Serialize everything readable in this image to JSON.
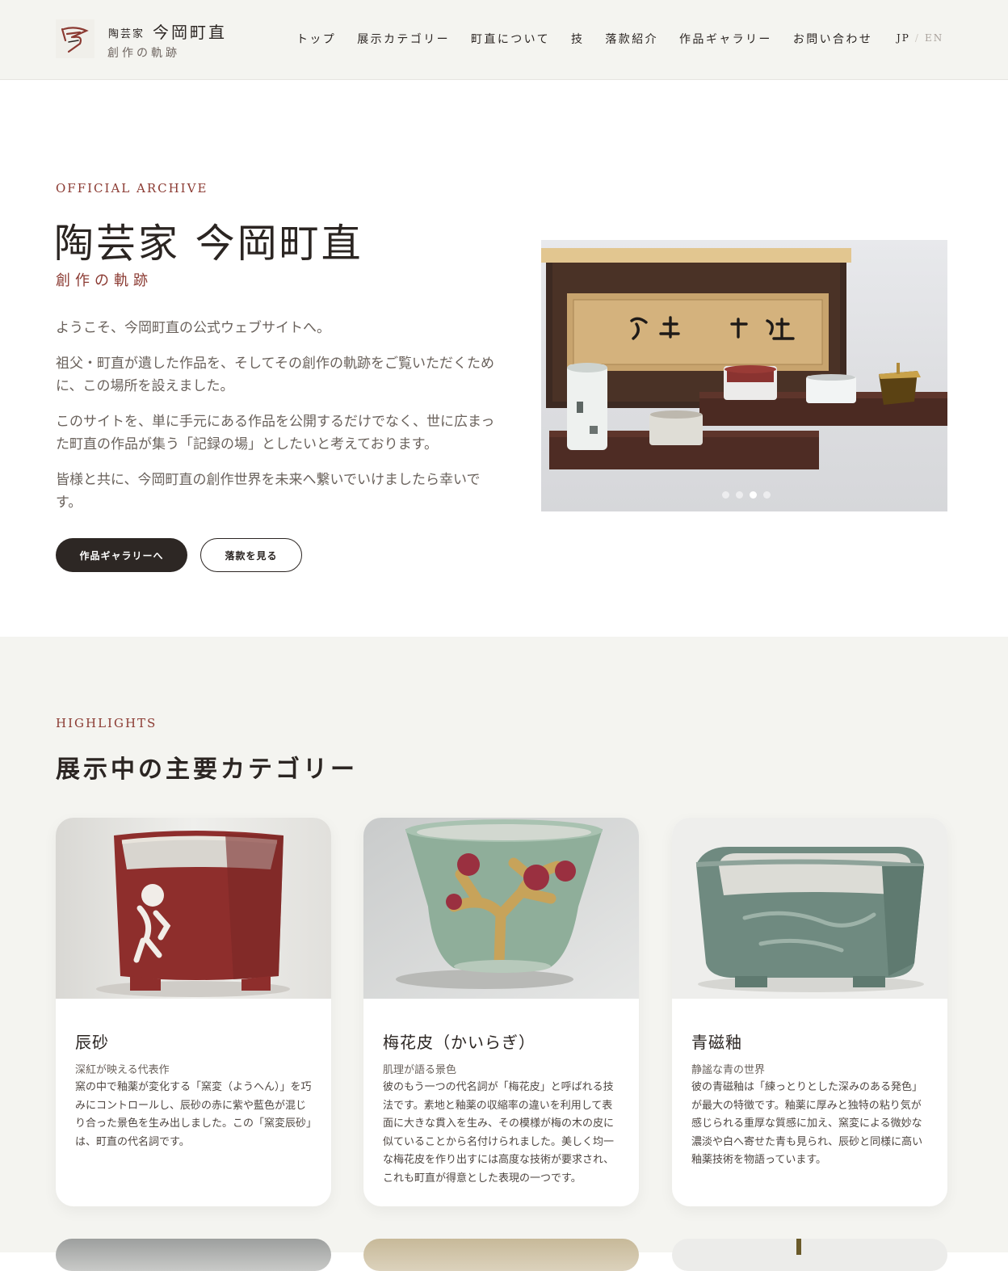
{
  "header": {
    "logo_small": "陶芸家",
    "logo_name": "今岡町直",
    "logo_sub": "創作の軌跡",
    "nav": [
      "トップ",
      "展示カテゴリー",
      "町直について",
      "技",
      "落款紹介",
      "作品ギャラリー",
      "お問い合わせ"
    ],
    "lang_jp": "JP",
    "lang_sep": "/",
    "lang_en": "EN"
  },
  "hero": {
    "eyebrow": "OFFICIAL ARCHIVE",
    "title": "陶芸家 今岡町直",
    "subtitle": "創作の軌跡",
    "paragraphs": [
      "ようこそ、今岡町直の公式ウェブサイトへ。",
      "祖父・町直が遺した作品を、そしてその創作の軌跡をご覧いただくために、この場所を設えました。",
      "このサイトを、単に手元にある作品を公開するだけでなく、世に広まった町直の作品が集う「記録の場」としたいと考えております。",
      "皆様と共に、今岡町直の創作世界を未来へ繋いでいけましたら幸いです。"
    ],
    "primary_button": "作品ギャラリーへ",
    "secondary_button": "落款を見る",
    "slider_total": 4,
    "slider_active": 3
  },
  "highlights": {
    "eyebrow": "HIGHLIGHTS",
    "title": "展示中の主要カテゴリー",
    "cards": [
      {
        "title": "辰砂",
        "subtitle": "深紅が映える代表作",
        "body": "窯の中で釉薬が変化する「窯変（ようへん）」を巧みにコントロールし、辰砂の赤に紫や藍色が混じり合った景色を生み出しました。この「窯変辰砂」は、町直の代名詞です。"
      },
      {
        "title": "梅花皮（かいらぎ）",
        "subtitle": "肌理が語る景色",
        "body": "彼のもう一つの代名詞が「梅花皮」と呼ばれる技法です。素地と釉薬の収縮率の違いを利用して表面に大きな貫入を生み、その模様が梅の木の皮に似ていることから名付けられました。美しく均一な梅花皮を作り出すには高度な技術が要求され、これも町直が得意とした表現の一つです。"
      },
      {
        "title": "青磁釉",
        "subtitle": "静謐な青の世界",
        "body": "彼の青磁釉は「練っとりとした深みのある発色」が最大の特徴です。釉薬に厚みと独特の粘り気が感じられる重厚な質感に加え、窯変による微妙な濃淡や白へ寄せた青も見られ、辰砂と同様に高い釉薬技術を物語っています。"
      }
    ]
  },
  "colors": {
    "accent": "#8b3a32",
    "dark": "#2d2724",
    "section_bg": "#f4f4f0"
  }
}
